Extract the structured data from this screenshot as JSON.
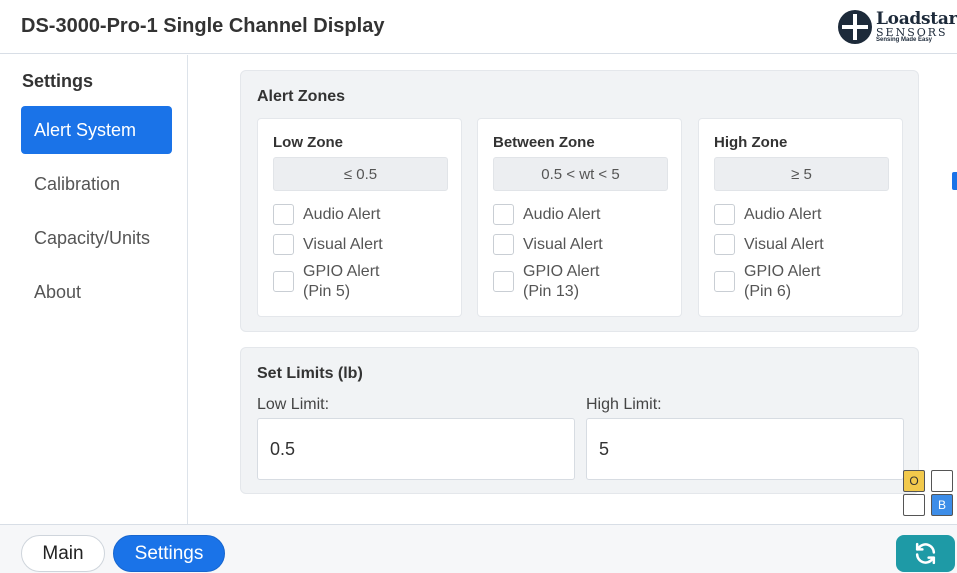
{
  "header": {
    "title": "DS-3000-Pro-1 Single Channel Display",
    "logo": {
      "brand": "Loadstar",
      "sub": "SENSORS",
      "tagline": "Sensing Made Easy",
      "icon": "loadstar-logo-icon"
    }
  },
  "sidebar": {
    "heading": "Settings",
    "items": [
      {
        "label": "Alert System",
        "active": true
      },
      {
        "label": "Calibration",
        "active": false
      },
      {
        "label": "Capacity/Units",
        "active": false
      },
      {
        "label": "About",
        "active": false
      }
    ]
  },
  "alert_zones": {
    "title": "Alert Zones",
    "zones": [
      {
        "name": "Low Zone",
        "range": "≤ 0.5",
        "audio": "Audio Alert",
        "visual": "Visual Alert",
        "gpio_line1": "GPIO Alert",
        "gpio_line2": "(Pin 5)"
      },
      {
        "name": "Between Zone",
        "range": "0.5 < wt < 5",
        "audio": "Audio Alert",
        "visual": "Visual Alert",
        "gpio_line1": "GPIO Alert",
        "gpio_line2": "(Pin 13)"
      },
      {
        "name": "High Zone",
        "range": "≥ 5",
        "audio": "Audio Alert",
        "visual": "Visual Alert",
        "gpio_line1": "GPIO Alert",
        "gpio_line2": "(Pin 6)"
      }
    ]
  },
  "limits": {
    "title": "Set Limits (lb)",
    "low_label": "Low Limit:",
    "low_value": "0.5",
    "high_label": "High Limit:",
    "high_value": "5"
  },
  "indicators": {
    "o_label": "O",
    "b_label": "B"
  },
  "footer": {
    "main_label": "Main",
    "settings_label": "Settings",
    "refresh_icon": "refresh-icon"
  },
  "colors": {
    "accent": "#1a73e8",
    "refresh": "#1e9aa6",
    "indicator_o": "#f2c94c",
    "indicator_b": "#3d8de8"
  }
}
